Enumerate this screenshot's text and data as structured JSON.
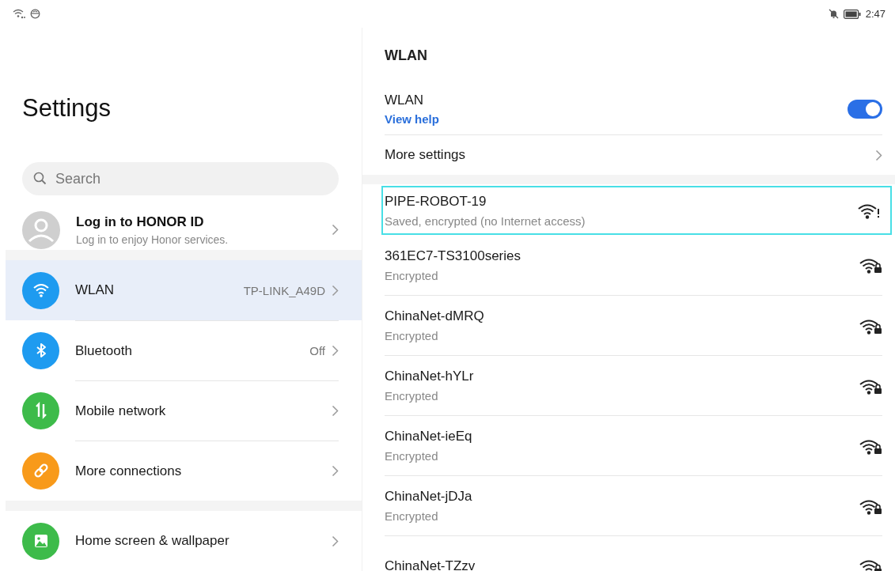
{
  "status_bar": {
    "time": "2:47"
  },
  "sidebar": {
    "title": "Settings",
    "search": {
      "placeholder": "Search"
    },
    "account": {
      "title": "Log in to HONOR ID",
      "subtitle": "Log in to enjoy Honor services."
    },
    "groups": [
      {
        "items": [
          {
            "kind": "wlan",
            "label": "WLAN",
            "value": "TP-LINK_A49D",
            "color": "#1e9bf0",
            "selected": true
          },
          {
            "kind": "bluetooth",
            "label": "Bluetooth",
            "value": "Off",
            "color": "#1e9bf0",
            "selected": false
          },
          {
            "kind": "mobile",
            "label": "Mobile network",
            "color": "#3dbb4a",
            "selected": false
          },
          {
            "kind": "link",
            "label": "More connections",
            "color": "#f89a1a",
            "selected": false
          }
        ]
      },
      {
        "items": [
          {
            "kind": "wallpaper",
            "label": "Home screen & wallpaper",
            "color": "#3dbb4a",
            "selected": false
          }
        ]
      }
    ]
  },
  "wlan": {
    "title": "WLAN",
    "toggle": {
      "label": "WLAN",
      "link": "View help",
      "on": true
    },
    "more": "More settings",
    "networks": [
      {
        "name": "PIPE-ROBOT-19",
        "status": "Saved, encrypted (no Internet access)",
        "kind": "no-internet",
        "highlighted": true
      },
      {
        "name": "361EC7-TS3100series",
        "status": "Encrypted",
        "kind": "locked",
        "highlighted": false
      },
      {
        "name": "ChinaNet-dMRQ",
        "status": "Encrypted",
        "kind": "locked",
        "highlighted": false
      },
      {
        "name": "ChinaNet-hYLr",
        "status": "Encrypted",
        "kind": "locked",
        "highlighted": false
      },
      {
        "name": "ChinaNet-ieEq",
        "status": "Encrypted",
        "kind": "locked",
        "highlighted": false
      },
      {
        "name": "ChinaNet-jDJa",
        "status": "Encrypted",
        "kind": "locked",
        "highlighted": false
      },
      {
        "name": "ChinaNet-TZzv",
        "kind": "locked",
        "highlighted": false
      }
    ]
  }
}
